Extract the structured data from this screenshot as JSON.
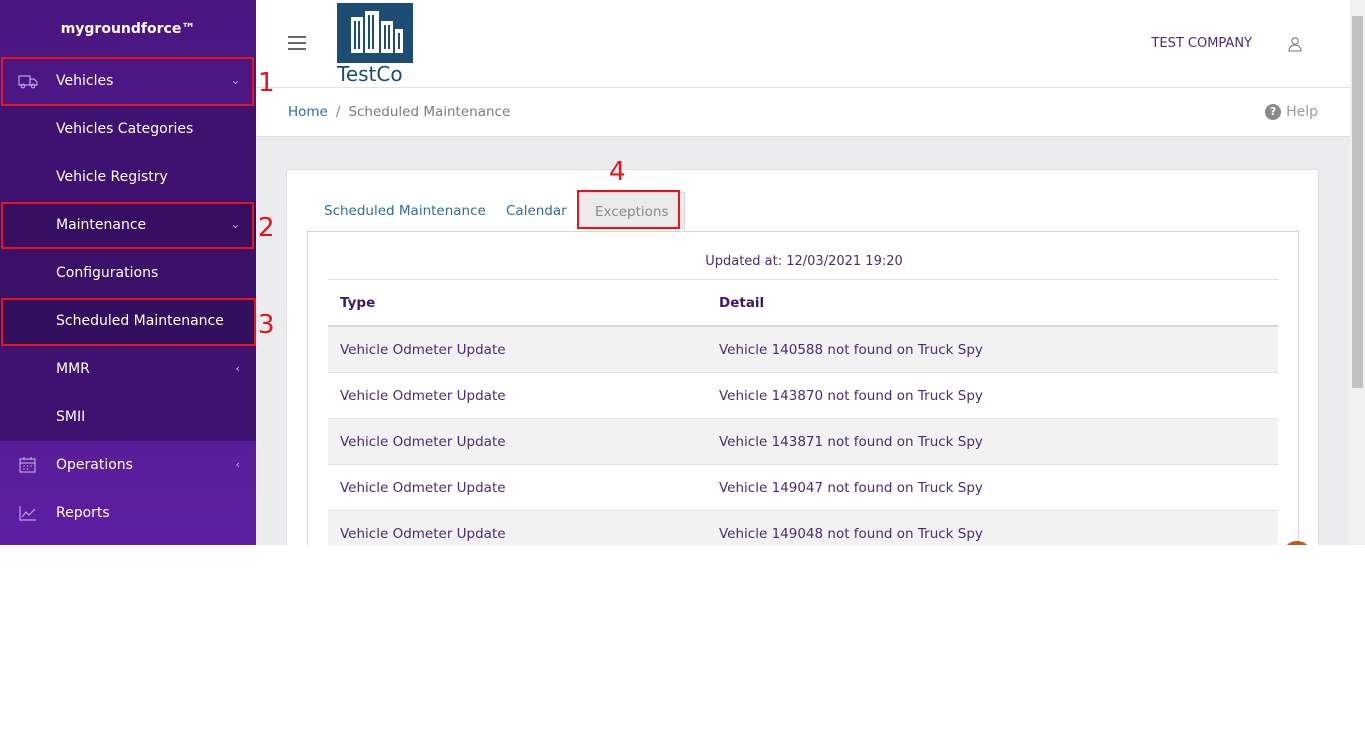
{
  "sidebar": {
    "brand": "mygroundforce™",
    "items": [
      {
        "label": "Vehicles",
        "chevron": "⌄",
        "icon": "truck-icon"
      },
      {
        "label": "Vehicles Categories"
      },
      {
        "label": "Vehicle Registry"
      },
      {
        "label": "Maintenance",
        "chevron": "⌄"
      },
      {
        "label": "Configurations"
      },
      {
        "label": "Scheduled Maintenance"
      },
      {
        "label": "MMR",
        "chevron": "‹"
      },
      {
        "label": "SMII"
      },
      {
        "label": "Operations",
        "chevron": "‹",
        "icon": "calendar-icon"
      },
      {
        "label": "Reports",
        "icon": "chart-line-icon"
      }
    ]
  },
  "annotations": [
    "1",
    "2",
    "3",
    "4"
  ],
  "header": {
    "logo_text": "TestCo",
    "company": "TEST COMPANY"
  },
  "breadcrumb": {
    "home": "Home",
    "separator": "/",
    "current": "Scheduled Maintenance",
    "help": "Help"
  },
  "tabs": [
    {
      "label": "Scheduled Maintenance"
    },
    {
      "label": "Calendar"
    },
    {
      "label": "Exceptions",
      "active": true
    }
  ],
  "exceptions": {
    "updated": "Updated at: 12/03/2021 19:20",
    "columns": [
      "Type",
      "Detail"
    ],
    "rows": [
      {
        "type": "Vehicle Odmeter Update",
        "detail": "Vehicle 140588 not found on Truck Spy"
      },
      {
        "type": "Vehicle Odmeter Update",
        "detail": "Vehicle 143870 not found on Truck Spy"
      },
      {
        "type": "Vehicle Odmeter Update",
        "detail": "Vehicle 143871 not found on Truck Spy"
      },
      {
        "type": "Vehicle Odmeter Update",
        "detail": "Vehicle 149047 not found on Truck Spy"
      },
      {
        "type": "Vehicle Odmeter Update",
        "detail": "Vehicle 149048 not found on Truck Spy"
      }
    ]
  },
  "colors": {
    "sidebar": "#4a1680",
    "annotation": "#e8131b",
    "link": "#2d6f9a",
    "text": "#4a2c73"
  }
}
